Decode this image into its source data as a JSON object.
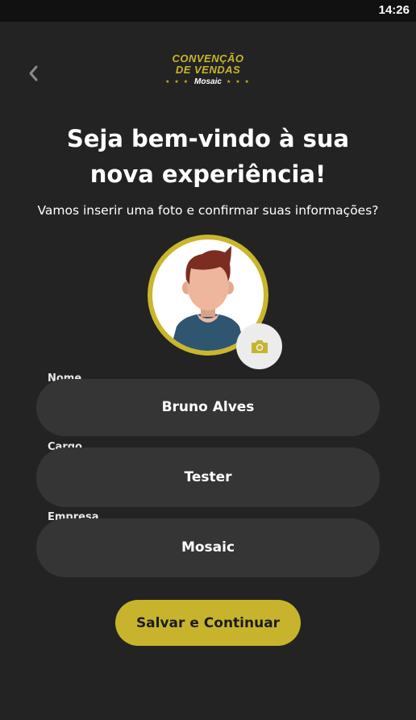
{
  "status_bar": {
    "time": "14:26"
  },
  "header": {
    "back_icon": "chevron-left-icon",
    "logo": {
      "line1": "CONVENÇÃO",
      "line2": "DE VENDAS",
      "brand": "Mosaic",
      "stars": "★ ★ ★"
    }
  },
  "welcome": {
    "title_line1": "Seja bem-vindo à sua",
    "title_line2": "nova experiência!",
    "subtitle": "Vamos inserir uma foto e confirmar suas informações?"
  },
  "avatar": {
    "icon": "camera-icon",
    "ring_color": "#c9b62c"
  },
  "form": {
    "name": {
      "label": "Nome",
      "value": "Bruno Alves"
    },
    "role": {
      "label": "Cargo",
      "value": "Tester"
    },
    "company": {
      "label": "Empresa",
      "value": "Mosaic"
    }
  },
  "actions": {
    "save_label": "Salvar e Continuar"
  },
  "colors": {
    "accent": "#c7b42c",
    "background": "#232323",
    "field": "#353535"
  }
}
